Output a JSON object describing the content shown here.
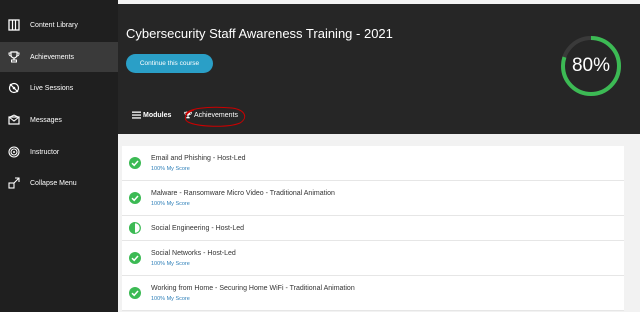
{
  "sidebar": {
    "items": [
      {
        "label": "Content Library",
        "icon": "library-icon",
        "active": false
      },
      {
        "label": "Achievements",
        "icon": "trophy-icon",
        "active": true
      },
      {
        "label": "Live Sessions",
        "icon": "live-sessions-icon",
        "active": false
      },
      {
        "label": "Messages",
        "icon": "envelope-icon",
        "active": false
      },
      {
        "label": "Instructor",
        "icon": "instructor-icon",
        "active": false
      },
      {
        "label": "Collapse Menu",
        "icon": "collapse-icon",
        "active": false
      }
    ]
  },
  "course": {
    "title": "Cybersecurity Staff Awareness Training - 2021",
    "continue_label": "Continue this course",
    "progress_text": "80%",
    "progress_percent": 80
  },
  "tabs": {
    "modules": "Modules",
    "achievements": "Achievements"
  },
  "modules": [
    {
      "title": "Email and Phishing - Host-Led",
      "score": "100% My Score",
      "status": "complete"
    },
    {
      "title": "Malware - Ransomware Micro Video - Traditional Animation",
      "score": "100% My Score",
      "status": "complete"
    },
    {
      "title": "Social Engineering - Host-Led",
      "score": "",
      "status": "in-progress"
    },
    {
      "title": "Social Networks - Host-Led",
      "score": "100% My Score",
      "status": "complete"
    },
    {
      "title": "Working from Home - Securing Home WiFi - Traditional Animation",
      "score": "100% My Score",
      "status": "complete"
    }
  ],
  "colors": {
    "accent": "#2a9fc7",
    "success": "#3cba54",
    "sidebar_bg": "#1f1f1f",
    "header_bg": "#262626",
    "link": "#2e7fb8",
    "annotation": "#cc0000"
  }
}
